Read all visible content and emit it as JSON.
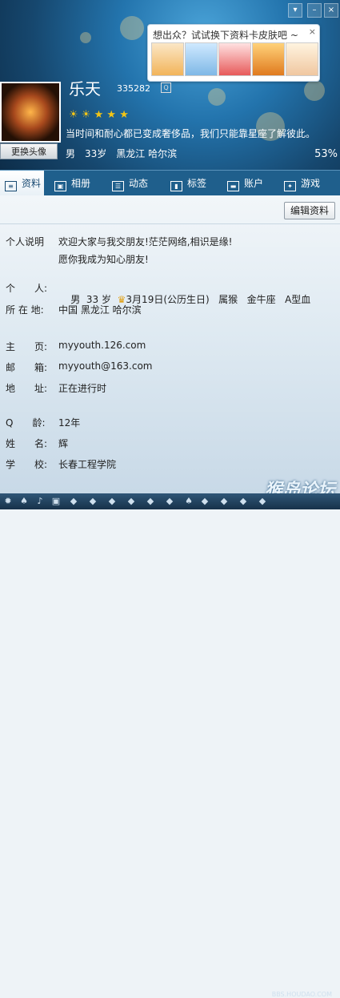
{
  "header": {
    "nickname": "乐天",
    "qq_number": "335282",
    "qq_badge": "Q",
    "level_icons": [
      "sun-icon",
      "sun-icon",
      "star-icon",
      "star-icon",
      "star-icon"
    ],
    "signature": "当时间和耐心都已变成奢侈品，我们只能靠星座了解彼此。",
    "basic_info": "男　33岁　黑龙江 哈尔滨",
    "completion_percent": "53%",
    "change_avatar_label": "更换头像",
    "tooltip": {
      "text": "想出众？试试换下资料卡皮肤吧 ~",
      "close": "×"
    }
  },
  "tabs": [
    {
      "label": "资料",
      "icon": "profile-card-icon"
    },
    {
      "label": "相册",
      "icon": "photo-album-icon"
    },
    {
      "label": "动态",
      "icon": "feed-list-icon"
    },
    {
      "label": "标签",
      "icon": "bookmark-tag-icon"
    },
    {
      "label": "账户",
      "icon": "briefcase-account-icon"
    },
    {
      "label": "游戏",
      "icon": "game-icon"
    }
  ],
  "edit_button_label": "编辑资料",
  "profile": {
    "intro_label": "个人说明",
    "intro_line1": "欢迎大家与我交朋友!茫茫网络,相识是缘!",
    "intro_line2": "愿你我成为知心朋友!",
    "personal_label": "个　　人:",
    "gender": "男",
    "age": "33 岁",
    "birthday": "3月19日(公历生日)",
    "zodiac": "属猴",
    "star_sign": "金牛座",
    "blood_type": "A型血",
    "location_label": "所 在 地:",
    "location": "中国 黑龙江 哈尔滨",
    "homepage_label": "主　　页:",
    "homepage": "myyouth.126.com",
    "email_label": "邮　　箱:",
    "email": "myyouth@163.com",
    "address_label": "地　　址:",
    "address": "正在进行时",
    "qage_label": "Q　　龄:",
    "qage": "12年",
    "name_label": "姓　　名:",
    "name": "辉",
    "school_label": "学　　校:",
    "school": "长春工程学院"
  },
  "watermark": "猴岛论坛",
  "watermark_url": "BBS.HOUDAO.COM",
  "colors": {
    "header_blue": "#2374ad",
    "tab_bar": "#1f5f8c",
    "accent_gold": "#f3c516"
  }
}
